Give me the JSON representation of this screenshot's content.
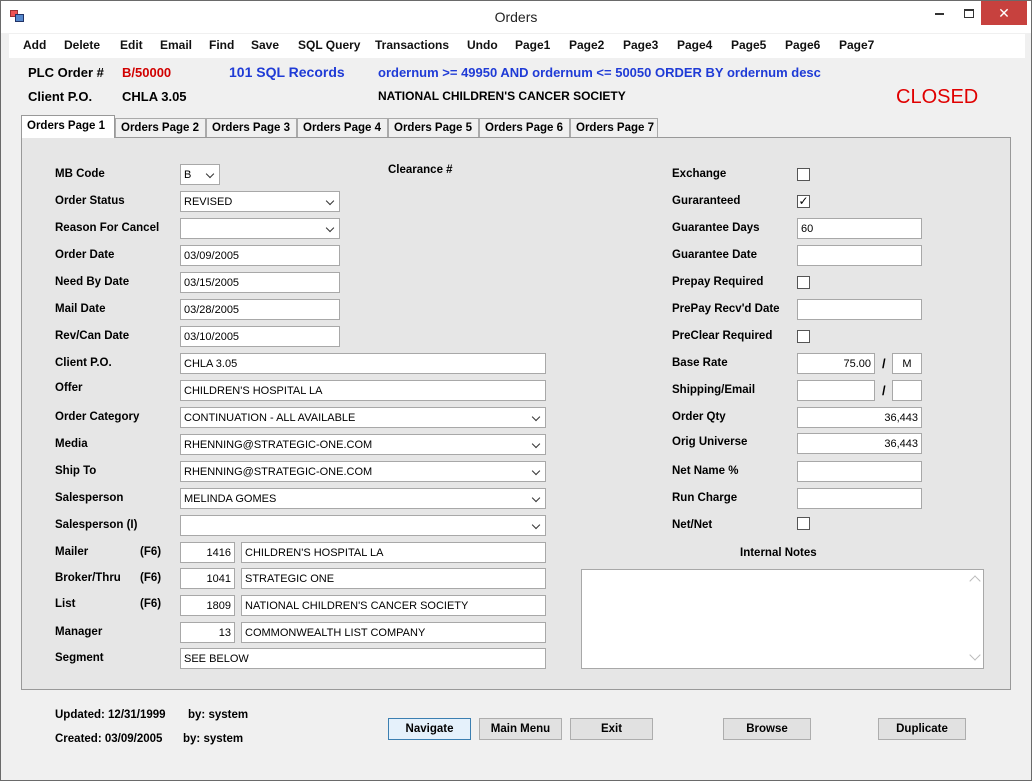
{
  "window": {
    "title": "Orders"
  },
  "menu": [
    "Add",
    "Delete",
    "Edit",
    "Email",
    "Find",
    "Save",
    "SQL Query",
    "Transactions",
    "Undo",
    "Page1",
    "Page2",
    "Page3",
    "Page4",
    "Page5",
    "Page6",
    "Page7"
  ],
  "header": {
    "plc_label": "PLC Order #",
    "plc_value": "B/50000",
    "records": "101 SQL Records",
    "sql": "ordernum >= 49950 AND ordernum <= 50050 ORDER BY ordernum desc",
    "client_po_label": "Client P.O.",
    "client_po_value": "CHLA 3.05",
    "society": "NATIONAL CHILDREN'S CANCER SOCIETY",
    "status": "CLOSED"
  },
  "tabs": [
    "Orders Page 1",
    "Orders Page 2",
    "Orders Page 3",
    "Orders Page 4",
    "Orders Page 5",
    "Orders Page 6",
    "Orders Page 7"
  ],
  "form": {
    "mb_code": {
      "label": "MB Code",
      "value": "B"
    },
    "clearance": {
      "label": "Clearance #"
    },
    "order_status": {
      "label": "Order Status",
      "value": "REVISED"
    },
    "reason_cancel": {
      "label": "Reason For Cancel",
      "value": ""
    },
    "order_date": {
      "label": "Order Date",
      "value": "03/09/2005"
    },
    "need_by_date": {
      "label": "Need By Date",
      "value": "03/15/2005"
    },
    "mail_date": {
      "label": "Mail Date",
      "value": "03/28/2005"
    },
    "rev_can_date": {
      "label": "Rev/Can Date",
      "value": "03/10/2005"
    },
    "client_po": {
      "label": "Client P.O.",
      "value": "CHLA 3.05"
    },
    "offer": {
      "label": "Offer",
      "value": "CHILDREN'S HOSPITAL LA"
    },
    "order_category": {
      "label": "Order Category",
      "value": "CONTINUATION - ALL AVAILABLE"
    },
    "media": {
      "label": "Media",
      "value": "RHENNING@STRATEGIC-ONE.COM"
    },
    "ship_to": {
      "label": "Ship To",
      "value": "RHENNING@STRATEGIC-ONE.COM"
    },
    "salesperson": {
      "label": "Salesperson",
      "value": "MELINDA GOMES"
    },
    "salesperson_i": {
      "label": "Salesperson (I)",
      "value": ""
    },
    "mailer": {
      "label": "Mailer",
      "key": "(F6)",
      "code": "1416",
      "name": "CHILDREN'S HOSPITAL LA"
    },
    "broker": {
      "label": "Broker/Thru",
      "key": "(F6)",
      "code": "1041",
      "name": "STRATEGIC ONE"
    },
    "list": {
      "label": "List",
      "key": "(F6)",
      "code": "1809",
      "name": "NATIONAL CHILDREN'S CANCER SOCIETY"
    },
    "manager": {
      "label": "Manager",
      "code": "13",
      "name": "COMMONWEALTH LIST COMPANY"
    },
    "segment": {
      "label": "Segment",
      "value": "SEE BELOW"
    },
    "exchange": {
      "label": "Exchange",
      "checked": false
    },
    "guaranteed": {
      "label": "Guraranteed",
      "checked": true,
      "mark": "✓"
    },
    "guarantee_days": {
      "label": "Guarantee Days",
      "value": "60"
    },
    "guarantee_date": {
      "label": "Guarantee Date",
      "value": ""
    },
    "prepay_required": {
      "label": "Prepay Required",
      "checked": false
    },
    "prepay_recvd": {
      "label": "PrePay Recv'd Date",
      "value": ""
    },
    "preclear_required": {
      "label": "PreClear Required",
      "checked": false
    },
    "base_rate": {
      "label": "Base Rate",
      "value": "75.00",
      "sep": "/",
      "unit": "M"
    },
    "shipping_email": {
      "label": "Shipping/Email",
      "value": "",
      "sep": "/",
      "unit": ""
    },
    "order_qty": {
      "label": "Order Qty",
      "value": "36,443"
    },
    "orig_universe": {
      "label": "Orig Universe",
      "value": "36,443"
    },
    "net_name": {
      "label": "Net Name %",
      "value": ""
    },
    "run_charge": {
      "label": "Run Charge",
      "value": ""
    },
    "net_net": {
      "label": "Net/Net",
      "checked": false
    },
    "internal_notes": {
      "label": "Internal Notes",
      "value": ""
    }
  },
  "footer": {
    "updated": "Updated: 12/31/1999",
    "updated_by": "by: system",
    "created": "Created: 03/09/2005",
    "created_by": "by: system"
  },
  "buttons": {
    "navigate": "Navigate",
    "main_menu": "Main Menu",
    "exit": "Exit",
    "browse": "Browse",
    "duplicate": "Duplicate"
  }
}
